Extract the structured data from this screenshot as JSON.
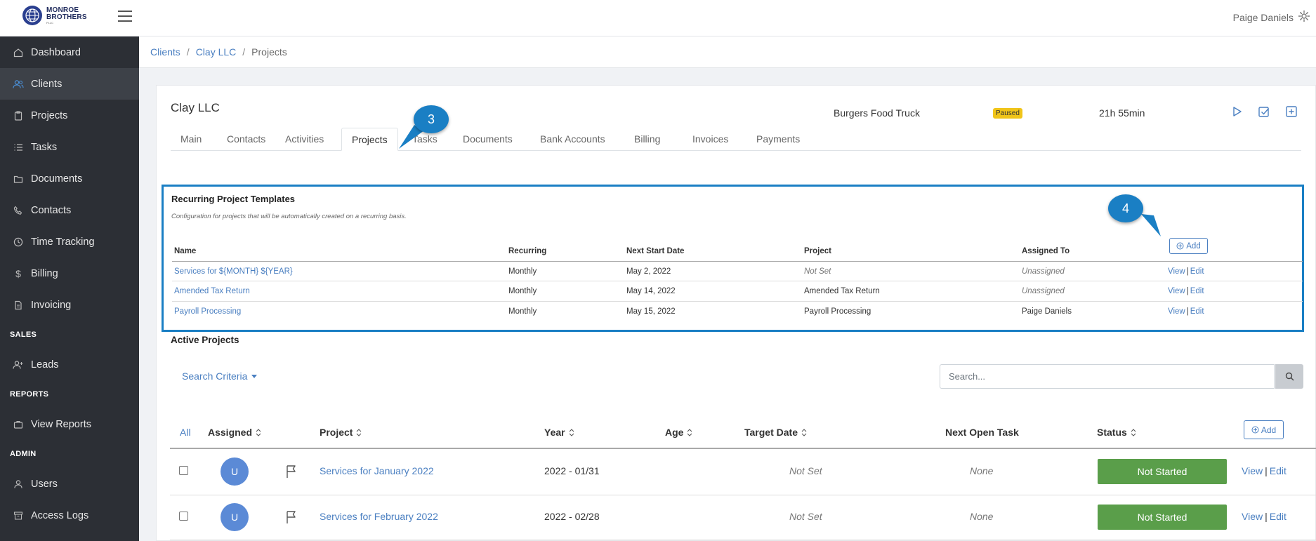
{
  "topbar": {
    "logo_line1": "MONROE",
    "logo_line2": "BROTHERS",
    "logo_line3": "PLLC",
    "user_name": "Paige Daniels"
  },
  "sidebar": {
    "items": [
      {
        "label": "Dashboard",
        "icon": "home-icon"
      },
      {
        "label": "Clients",
        "icon": "users-icon",
        "active": true
      },
      {
        "label": "Projects",
        "icon": "clipboard-icon"
      },
      {
        "label": "Tasks",
        "icon": "list-icon"
      },
      {
        "label": "Documents",
        "icon": "folder-icon"
      },
      {
        "label": "Contacts",
        "icon": "phone-icon"
      },
      {
        "label": "Time Tracking",
        "icon": "clock-icon"
      },
      {
        "label": "Billing",
        "icon": "dollar-icon"
      },
      {
        "label": "Invoicing",
        "icon": "invoice-icon"
      }
    ],
    "section_sales": "SALES",
    "leads": "Leads",
    "section_reports": "REPORTS",
    "view_reports": "View Reports",
    "section_admin": "ADMIN",
    "users": "Users",
    "access_logs": "Access Logs"
  },
  "breadcrumb": {
    "items": [
      "Clients",
      "Clay LLC",
      "Projects"
    ],
    "separator": "/"
  },
  "client": {
    "name": "Clay LLC",
    "timer_task": "Burgers Food Truck",
    "timer_status": "Paused",
    "timer_time": "21h 55min"
  },
  "tabs": [
    "Main",
    "Contacts",
    "Activities",
    "Projects",
    "Tasks",
    "Documents",
    "Bank Accounts",
    "Billing",
    "Invoices",
    "Payments"
  ],
  "callouts": {
    "one": "3",
    "two": "4"
  },
  "recurring": {
    "title": "Recurring Project Templates",
    "subtitle": "Configuration for projects that will be automatically created on a recurring basis.",
    "add_label": "Add",
    "columns": [
      "Name",
      "Recurring",
      "Next Start Date",
      "Project",
      "Assigned To"
    ],
    "rows": [
      {
        "name": "Services for ${MONTH} ${YEAR}",
        "recurring": "Monthly",
        "next_start": "May 2, 2022",
        "project": "Not Set",
        "assigned": "Unassigned"
      },
      {
        "name": "Amended Tax Return",
        "recurring": "Monthly",
        "next_start": "May 14, 2022",
        "project": "Amended Tax Return",
        "assigned": "Unassigned"
      },
      {
        "name": "Payroll Processing",
        "recurring": "Monthly",
        "next_start": "May 15, 2022",
        "project": "Payroll Processing",
        "assigned": "Paige Daniels"
      }
    ],
    "view_label": "View",
    "edit_label": "Edit",
    "pipe": "|"
  },
  "active": {
    "title": "Active Projects",
    "search_criteria": "Search Criteria",
    "search_placeholder": "Search...",
    "columns": {
      "all": "All",
      "assigned": "Assigned",
      "project": "Project",
      "year": "Year",
      "age": "Age",
      "target_date": "Target Date",
      "next_open_task": "Next Open Task",
      "status": "Status"
    },
    "add_label": "Add",
    "rows": [
      {
        "avatar": "U",
        "project": "Services for January 2022",
        "year": "2022 - 01/31",
        "target_date": "Not Set",
        "next_task": "None",
        "status": "Not Started"
      },
      {
        "avatar": "U",
        "project": "Services for February 2022",
        "year": "2022 - 02/28",
        "target_date": "Not Set",
        "next_task": "None",
        "status": "Not Started"
      }
    ],
    "view_label": "View",
    "edit_label": "Edit",
    "pipe": "|"
  },
  "colors": {
    "sidebar_bg": "#2c2f35",
    "accent": "#4a7fc1",
    "callout": "#1a7fc4",
    "status_green": "#5a9e4a",
    "paused_badge": "#f0c419"
  }
}
